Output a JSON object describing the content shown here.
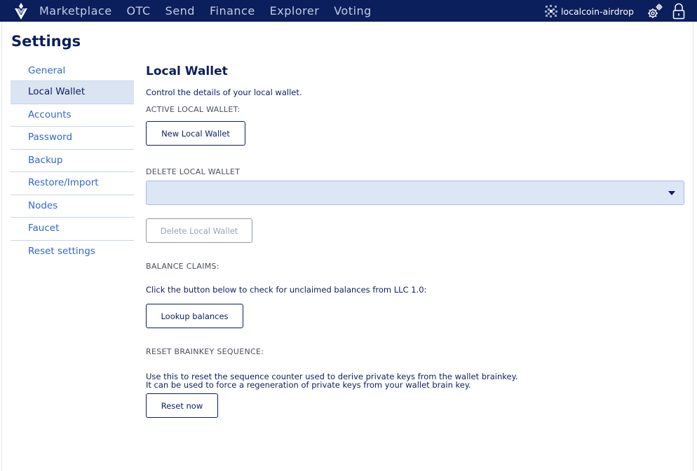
{
  "nav": {
    "items": [
      {
        "label": "Marketplace"
      },
      {
        "label": "OTC"
      },
      {
        "label": "Send"
      },
      {
        "label": "Finance"
      },
      {
        "label": "Explorer"
      },
      {
        "label": "Voting"
      }
    ],
    "account_name": "localcoin-airdrop"
  },
  "page": {
    "title": "Settings"
  },
  "sidebar": {
    "items": [
      {
        "label": "General"
      },
      {
        "label": "Local Wallet"
      },
      {
        "label": "Accounts"
      },
      {
        "label": "Password"
      },
      {
        "label": "Backup"
      },
      {
        "label": "Restore/Import"
      },
      {
        "label": "Nodes"
      },
      {
        "label": "Faucet"
      },
      {
        "label": "Reset settings"
      }
    ],
    "active": "Local Wallet"
  },
  "main": {
    "title": "Local Wallet",
    "description": "Control the details of your local wallet.",
    "active_wallet_label": "ACTIVE LOCAL WALLET:",
    "new_wallet_button": "New Local Wallet",
    "delete_wallet_label": "DELETE LOCAL WALLET",
    "delete_wallet_select_value": "",
    "delete_wallet_button": "Delete Local Wallet",
    "balance_claims_label": "BALANCE CLAIMS:",
    "balance_claims_text": "Click the button below to check for unclaimed balances from LLC 1.0:",
    "lookup_button": "Lookup balances",
    "reset_brainkey_label": "RESET BRAINKEY SEQUENCE:",
    "reset_brainkey_text_1": "Use this to reset the sequence counter used to derive private keys from the wallet brainkey.",
    "reset_brainkey_text_2": "It can be used to force a regeneration of private keys from your wallet brain key.",
    "reset_button": "Reset now"
  },
  "colors": {
    "navbar": "#0b1f5c",
    "link": "#3366cc",
    "active_bg": "#dbe4f3",
    "select_bg": "#dde6f4"
  },
  "icons": {
    "logo": "localcoin-logo-icon",
    "account": "identicon-icon",
    "settings": "gear-icon",
    "lock": "lock-icon",
    "dropdown": "caret-down-icon"
  }
}
